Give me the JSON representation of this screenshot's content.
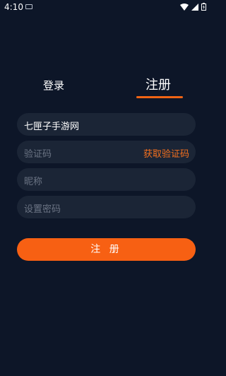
{
  "status": {
    "time": "4:10",
    "icons": [
      "notification-icon",
      "wifi-icon",
      "signal-icon",
      "battery-icon"
    ]
  },
  "tabs": {
    "login_label": "登录",
    "register_label": "注册",
    "active": "register",
    "accent": "#f06414"
  },
  "form": {
    "username": {
      "value": "七匣子手游网"
    },
    "code": {
      "placeholder": "验证码",
      "get_code_label": "获取验证码"
    },
    "nickname": {
      "placeholder": "昵称"
    },
    "password": {
      "placeholder": "设置密码"
    },
    "submit_label": "注 册"
  },
  "colors": {
    "background": "#0d1628",
    "field_bg": "#1b2536",
    "button": "#f76013",
    "link": "#f5701e"
  }
}
